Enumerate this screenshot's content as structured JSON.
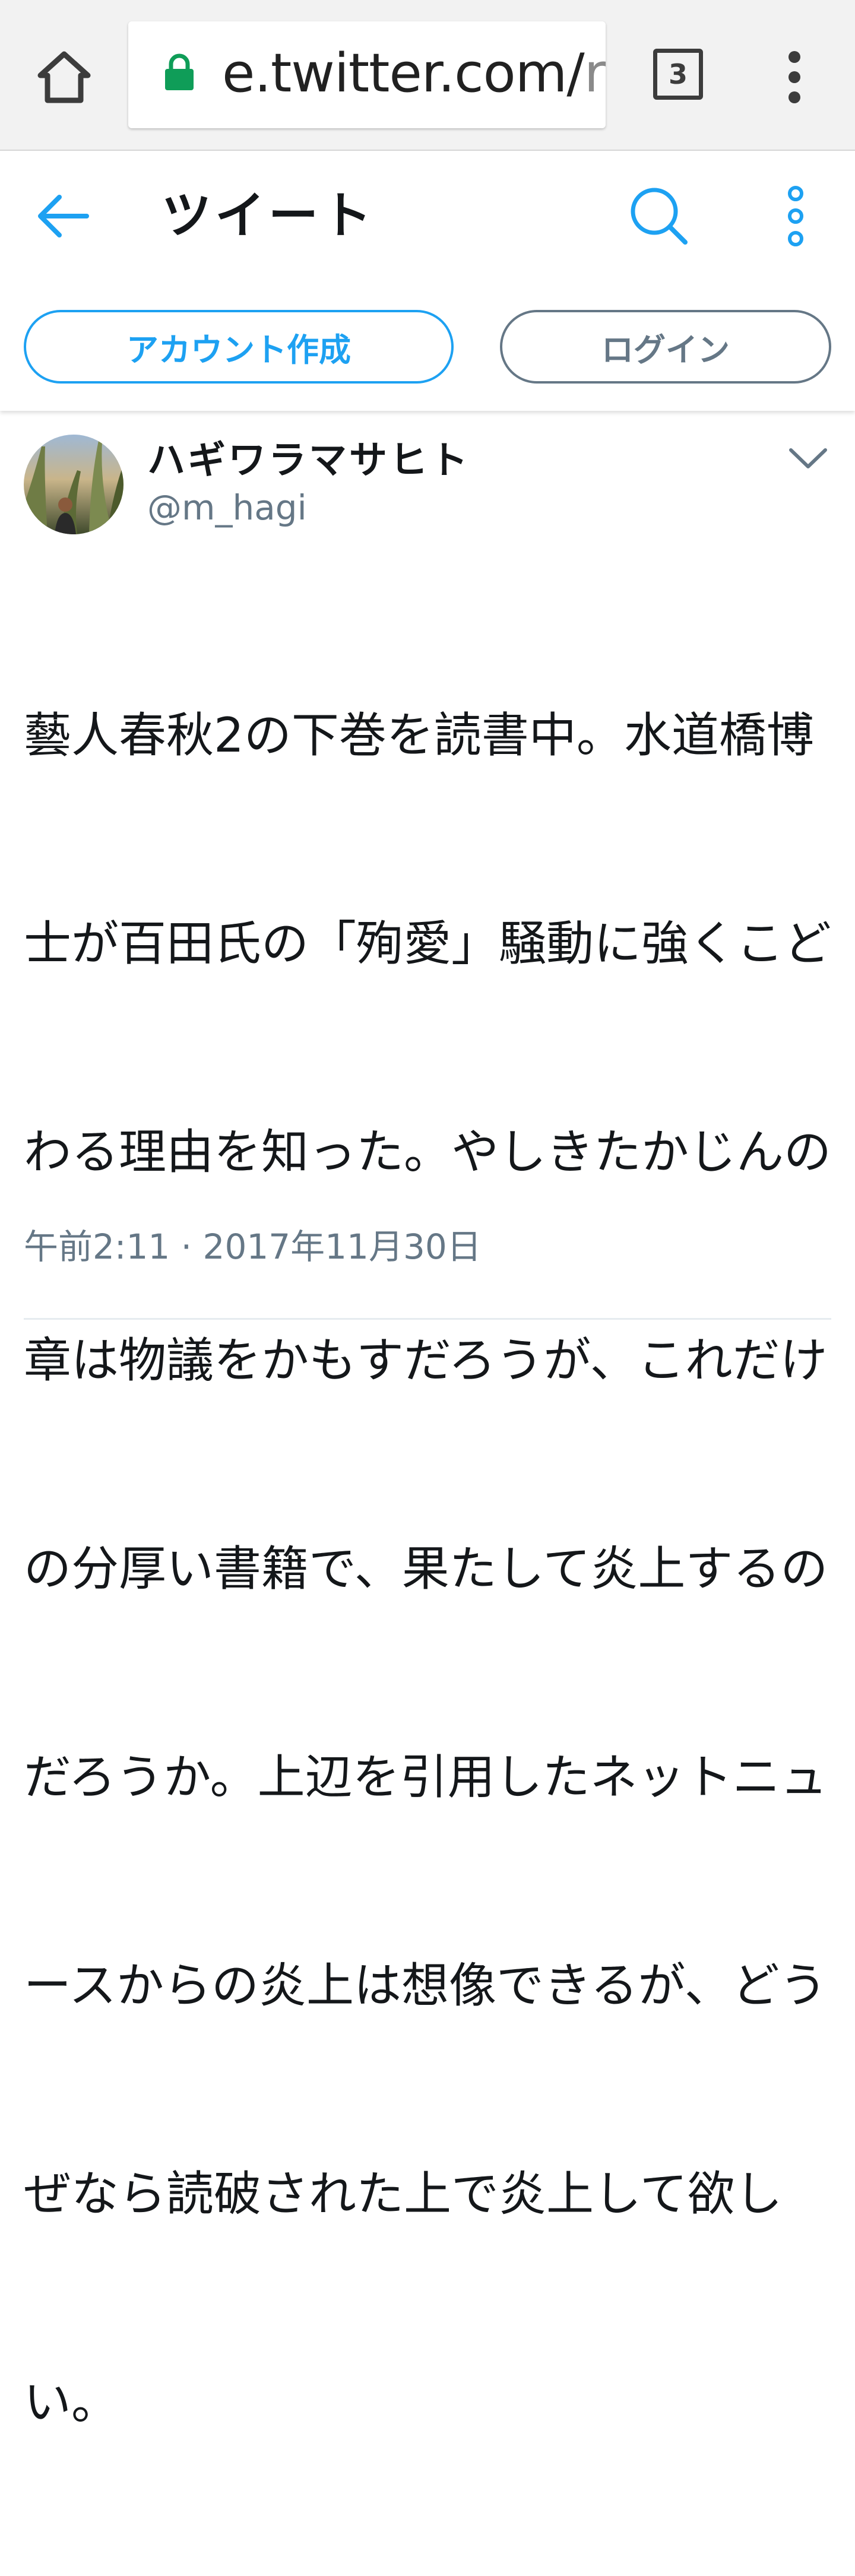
{
  "browser": {
    "url_main": "e.twitter.com/",
    "url_rest": "r",
    "tab_count": "3",
    "icons": [
      "home-icon",
      "lock-icon",
      "tab-switcher-icon",
      "overflow-menu-icon"
    ]
  },
  "header": {
    "title": "ツイート",
    "icons": [
      "back-arrow-icon",
      "search-icon",
      "more-options-icon"
    ],
    "accent_color": "#1da1f2"
  },
  "auth": {
    "signup_label": "アカウント作成",
    "login_label": "ログイン"
  },
  "tweet": {
    "display_name": "ハギワラマサヒト",
    "handle": "@m_hagi",
    "lines": [
      "藝人春秋2の下巻を読書中。水道橋博",
      "士が百田氏の「殉愛」騒動に強くこど",
      "わる理由を知った。やしきたかじんの",
      "章は物議をかもすだろうが、これだけ",
      "の分厚い書籍で、果たして炎上するの",
      "だろうか。上辺を引用したネットニュ",
      "ースからの炎上は想像できるが、どう",
      "ぜなら読破された上で炎上して欲し",
      "い。"
    ],
    "timestamp": "午前2:11 · 2017年11月30日",
    "icons": [
      "avatar",
      "chevron-down-icon"
    ]
  }
}
